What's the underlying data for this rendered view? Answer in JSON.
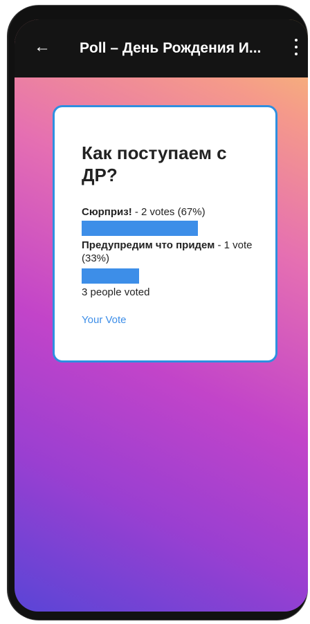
{
  "appbar": {
    "back_icon": "arrow-left-icon",
    "title": "Poll – День Рождения И...",
    "more_icon": "more-vertical-icon"
  },
  "poll": {
    "question": "Как поступаем с ДР?",
    "options": [
      {
        "label": "Сюрприз!",
        "separator": " - ",
        "votes_text": "2 votes (67%)",
        "fraction": 0.67
      },
      {
        "label": "Предупредим что придем",
        "separator": " - ",
        "votes_text": "1 vote (33%)",
        "fraction": 0.33
      }
    ],
    "total_text": "3 people voted",
    "your_vote_label": "Your Vote",
    "bar_color": "#3d8ee8"
  }
}
